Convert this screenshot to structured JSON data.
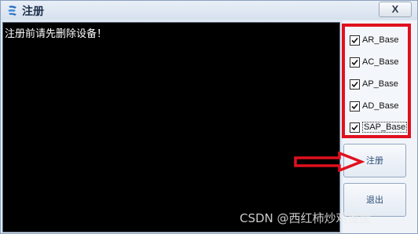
{
  "window": {
    "title": "注册",
    "close_label": "X"
  },
  "console": {
    "message": "注册前请先删除设备！"
  },
  "checkboxes": [
    {
      "label": "AR_Base",
      "checked": true
    },
    {
      "label": "AC_Base",
      "checked": true
    },
    {
      "label": "AP_Base",
      "checked": true
    },
    {
      "label": "AD_Base",
      "checked": true
    },
    {
      "label": "SAP_Base",
      "checked": true,
      "focused": true
    }
  ],
  "buttons": {
    "register": "注册",
    "exit": "退出"
  },
  "annotation": {
    "highlight_color": "#e0101e",
    "arrow_color": "#e0101e"
  },
  "watermark": "CSDN @西红柿炒鸡蛋面"
}
